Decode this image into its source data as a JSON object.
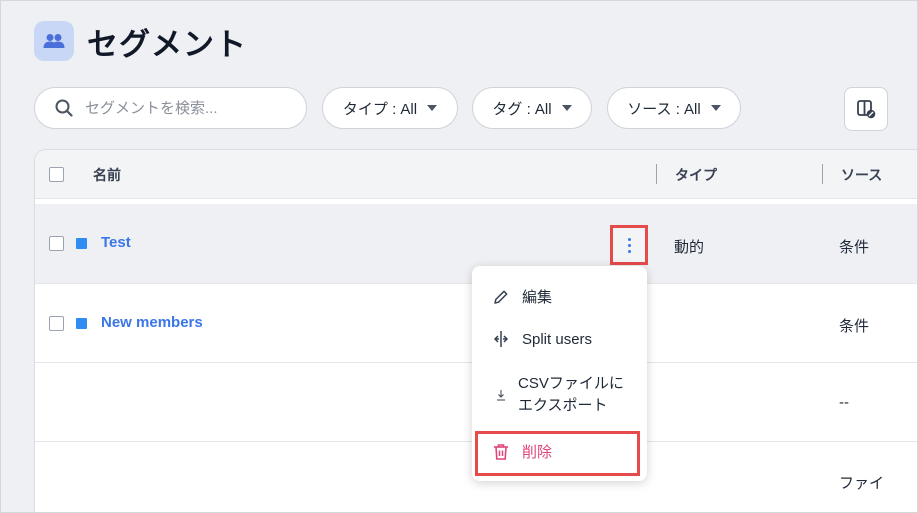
{
  "page": {
    "title": "セグメント"
  },
  "toolbar": {
    "search_placeholder": "セグメントを検索...",
    "filters": [
      {
        "label": "タイプ : All"
      },
      {
        "label": "タグ : All"
      },
      {
        "label": "ソース : All"
      }
    ]
  },
  "table": {
    "columns": {
      "name": "名前",
      "type": "タイプ",
      "source": "ソース"
    },
    "rows": [
      {
        "name": "Test",
        "type": "動的",
        "source": "条件",
        "color": "#2f8cf0"
      },
      {
        "name": "New members",
        "type": "",
        "source": "条件",
        "color": "#2f8cf0"
      },
      {
        "name": "",
        "type": "",
        "source": "--"
      },
      {
        "name": "",
        "type": "",
        "source": "ファイ"
      }
    ]
  },
  "context_menu": {
    "edit": "編集",
    "split": "Split users",
    "export_line1": "CSVファイルに",
    "export_line2": "エクスポート",
    "delete": "削除"
  },
  "colors": {
    "accent": "#3b76e8",
    "danger": "#e0457b",
    "highlight": "#e54b4b"
  }
}
